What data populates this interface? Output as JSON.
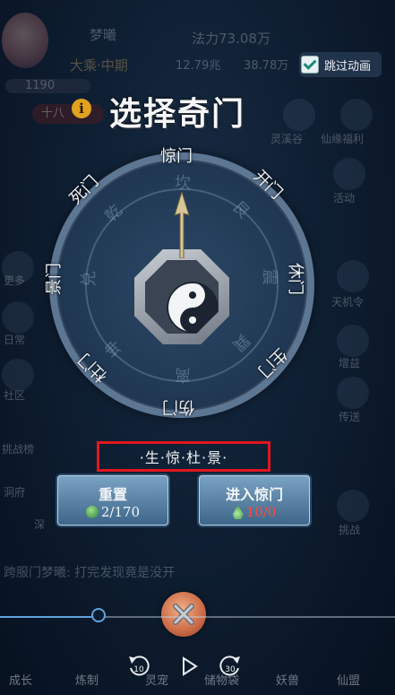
{
  "hud": {
    "player_name": "梦曦",
    "realm": "大乘·中期",
    "power": "法力73.08万",
    "resource_a": "12.79兆",
    "resource_b": "38.78万",
    "hp": "1190",
    "rank_badge": "十八"
  },
  "title": "选择奇门",
  "skip_animation": {
    "label": "跳过动画",
    "checked": true
  },
  "side_menu_right": [
    "灵溪谷",
    "仙缘福利",
    "活动",
    "天机令",
    "增益",
    "传送",
    "挑战"
  ],
  "side_menu_left": [
    "更多",
    "日常",
    "社区",
    "挑战榜",
    "洞府",
    "深"
  ],
  "wheel": {
    "gates": [
      "惊门",
      "开门",
      "休门",
      "生门",
      "伤门",
      "杜门",
      "景门",
      "死门"
    ],
    "runes": [
      "坎",
      "艮",
      "震",
      "巽",
      "离",
      "坤",
      "兑",
      "乾"
    ]
  },
  "selected_gates": "·生·惊·杜·景·",
  "buttons": {
    "reset": {
      "label": "重置",
      "count": "2/170"
    },
    "enter": {
      "label": "进入惊门",
      "count": "10/0"
    }
  },
  "chat_line": "跨服门梦曦: 打完发现竟是没开",
  "video": {
    "progress": 0.25,
    "rewind": "10",
    "forward": "30"
  },
  "bottom_nav": [
    "成长",
    "炼制",
    "灵宠",
    "储物袋",
    "妖兽",
    "仙盟"
  ],
  "colors": {
    "highlight": "#e0161e",
    "accent": "#5fa2dd"
  }
}
